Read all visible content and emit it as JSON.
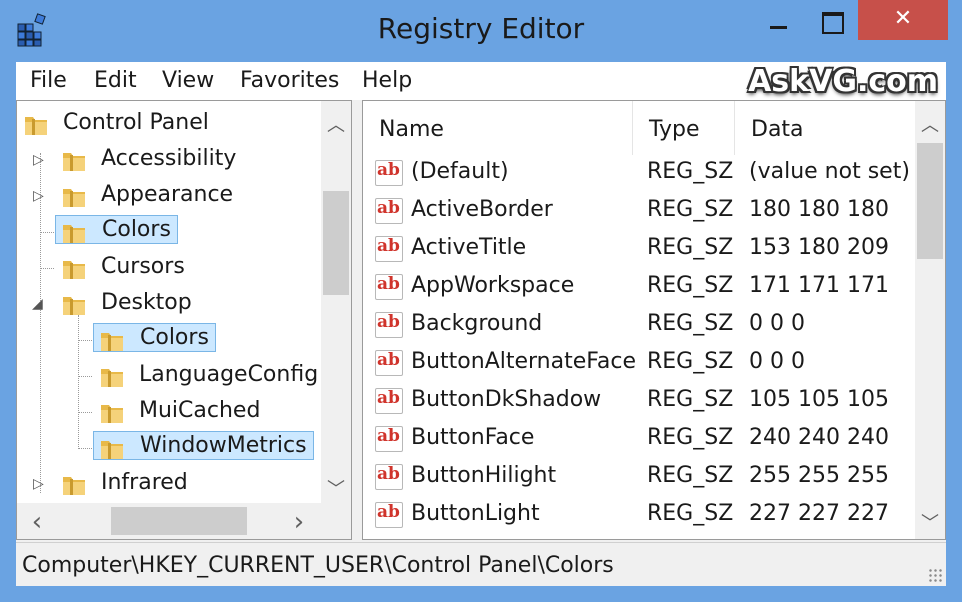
{
  "window": {
    "title": "Registry Editor",
    "accent": "#6aa3e2",
    "close_color": "#c7504a"
  },
  "titlebar_buttons": {
    "close_glyph": "✕"
  },
  "menu": [
    "File",
    "Edit",
    "View",
    "Favorites",
    "Help"
  ],
  "watermark": "AskVG.com",
  "tree": [
    {
      "label": "Control Panel",
      "expander": ""
    },
    {
      "label": "Accessibility",
      "expander": "▷"
    },
    {
      "label": "Appearance",
      "expander": "▷"
    },
    {
      "label": "Colors",
      "expander": ""
    },
    {
      "label": "Cursors",
      "expander": ""
    },
    {
      "label": "Desktop",
      "expander": "◢"
    },
    {
      "label": "Colors",
      "expander": ""
    },
    {
      "label": "LanguageConfig",
      "expander": ""
    },
    {
      "label": "MuiCached",
      "expander": ""
    },
    {
      "label": "WindowMetrics",
      "expander": ""
    },
    {
      "label": "Infrared",
      "expander": "▷"
    }
  ],
  "scroll_glyphs": {
    "up": "︿",
    "down": "﹀",
    "left": "‹",
    "right": "›"
  },
  "columns": [
    "Name",
    "Type",
    "Data"
  ],
  "values": [
    {
      "name": "(Default)",
      "type": "REG_SZ",
      "data": "(value not set)"
    },
    {
      "name": "ActiveBorder",
      "type": "REG_SZ",
      "data": "180 180 180"
    },
    {
      "name": "ActiveTitle",
      "type": "REG_SZ",
      "data": "153 180 209"
    },
    {
      "name": "AppWorkspace",
      "type": "REG_SZ",
      "data": "171 171 171"
    },
    {
      "name": "Background",
      "type": "REG_SZ",
      "data": "0 0 0"
    },
    {
      "name": "ButtonAlternateFace",
      "type": "REG_SZ",
      "data": "0 0 0"
    },
    {
      "name": "ButtonDkShadow",
      "type": "REG_SZ",
      "data": "105 105 105"
    },
    {
      "name": "ButtonFace",
      "type": "REG_SZ",
      "data": "240 240 240"
    },
    {
      "name": "ButtonHilight",
      "type": "REG_SZ",
      "data": "255 255 255"
    },
    {
      "name": "ButtonLight",
      "type": "REG_SZ",
      "data": "227 227 227"
    }
  ],
  "value_icon_text": "ab",
  "status": "Computer\\HKEY_CURRENT_USER\\Control Panel\\Colors"
}
